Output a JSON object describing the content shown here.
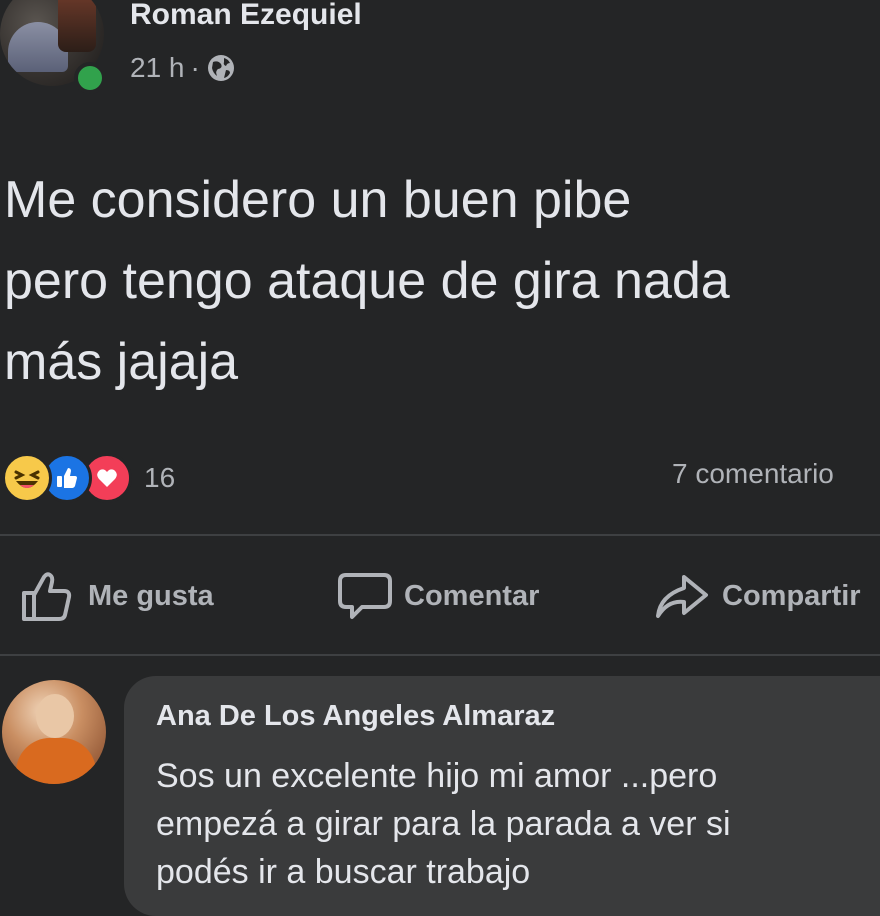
{
  "post": {
    "author": "Roman Ezequiel",
    "time": "21 h",
    "separator": "·",
    "privacy_icon": "globe-icon",
    "text": "Me considero un buen pibe\npero tengo ataque de gira nada\nmás jajaja",
    "reactions": {
      "icons": [
        "haha-reaction-icon",
        "like-reaction-icon",
        "love-reaction-icon"
      ],
      "count": "16"
    },
    "comment_count": "7 comentario"
  },
  "actions": {
    "like_label": "Me gusta",
    "comment_label": "Comentar",
    "share_label": "Compartir"
  },
  "comment": {
    "author": "Ana De Los Angeles Almaraz",
    "text": "Sos un excelente hijo mi amor ...pero\nempezá a girar para la parada a ver si\npodés ir a buscar trabajo"
  },
  "colors": {
    "background": "#242526",
    "text_primary": "#e4e6eb",
    "text_secondary": "#b0b3b8",
    "online": "#31a24c",
    "like_blue": "#1b74e4",
    "love_red": "#f33e58",
    "haha_yellow": "#f7c94a",
    "comment_bubble": "#3a3b3c"
  }
}
